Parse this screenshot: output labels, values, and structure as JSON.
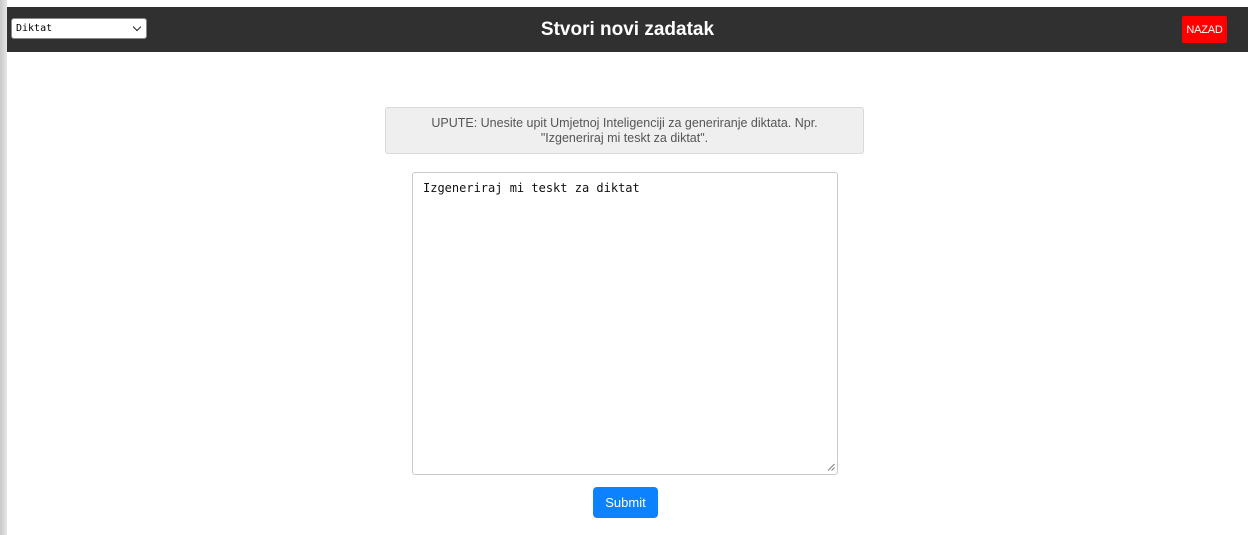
{
  "header": {
    "title": "Stvori novi zadatak",
    "mode_select": {
      "selected": "Diktat"
    },
    "back_label": "NAZAD"
  },
  "main": {
    "instructions": "UPUTE: Unesite upit Umjetnoj Inteligenciji za generiranje diktata. Npr. \"Izgeneriraj mi teskt za diktat\".",
    "prompt_value": "Izgeneriraj mi teskt za diktat",
    "submit_label": "Submit"
  },
  "colors": {
    "header_bg": "#303030",
    "back_button": "#ff0000",
    "submit_button": "#0d82ff",
    "instructions_bg": "#efefef"
  }
}
